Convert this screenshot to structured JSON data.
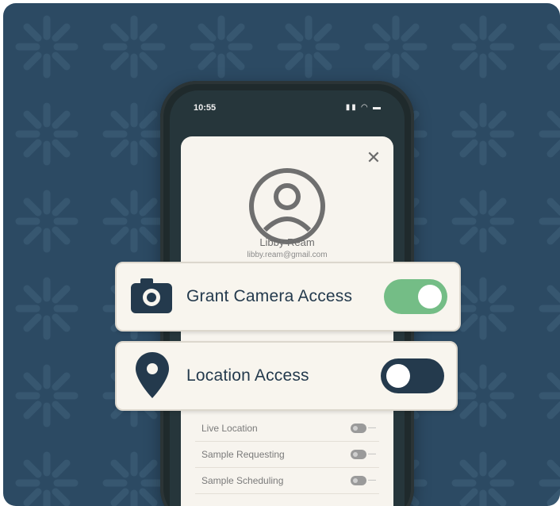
{
  "phone": {
    "status_time": "10:55",
    "status_icons": "▮▮ ◠ ▬",
    "close_glyph": "✕",
    "user": {
      "name": "Libby Ream",
      "email": "libby.ream@gmail.com"
    },
    "permission_rows": [
      {
        "label": "Live Location"
      },
      {
        "label": "Sample Requesting"
      },
      {
        "label": "Sample Scheduling"
      }
    ]
  },
  "camera_card": {
    "label": "Grant Camera Access",
    "icon": "camera-icon",
    "toggle_on": true,
    "toggle_color": "#74bd86"
  },
  "location_card": {
    "label": "Location Access",
    "icon": "location-pin-icon",
    "toggle_on": false,
    "toggle_color": "#243a4d"
  },
  "colors": {
    "background": "#2c4a63",
    "card": "#f8f5ee",
    "ink": "#243a4d"
  }
}
